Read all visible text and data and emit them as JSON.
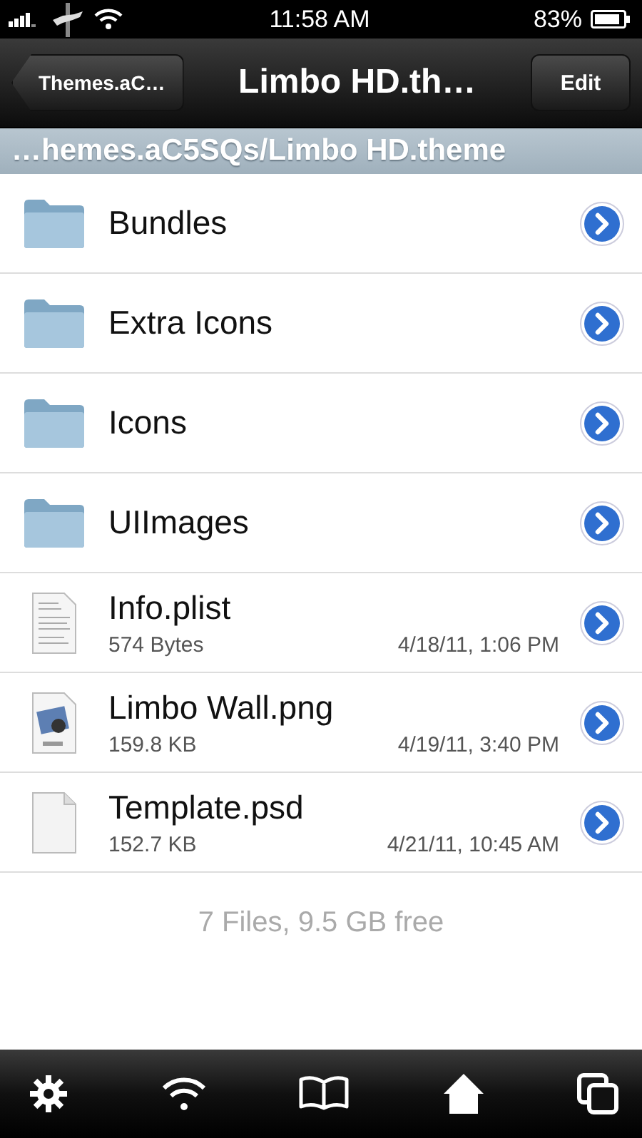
{
  "status_bar": {
    "time": "11:58 AM",
    "battery": "83%"
  },
  "nav_bar": {
    "back": "Themes.aC…",
    "title": "Limbo HD.th…",
    "edit": "Edit"
  },
  "path": "…hemes.aC5SQs/Limbo HD.theme",
  "rows": [
    {
      "kind": "folder",
      "name": "Bundles"
    },
    {
      "kind": "folder",
      "name": "Extra Icons"
    },
    {
      "kind": "folder",
      "name": "Icons"
    },
    {
      "kind": "folder",
      "name": "UIImages"
    },
    {
      "kind": "text-file",
      "name": "Info.plist",
      "size": "574 Bytes",
      "date": "4/18/11, 1:06 PM"
    },
    {
      "kind": "image-file",
      "name": "Limbo Wall.png",
      "size": "159.8 KB",
      "date": "4/19/11, 3:40 PM"
    },
    {
      "kind": "blank-file",
      "name": "Template.psd",
      "size": "152.7 KB",
      "date": "4/21/11, 10:45 AM"
    }
  ],
  "footer": "7 Files, 9.5 GB free"
}
